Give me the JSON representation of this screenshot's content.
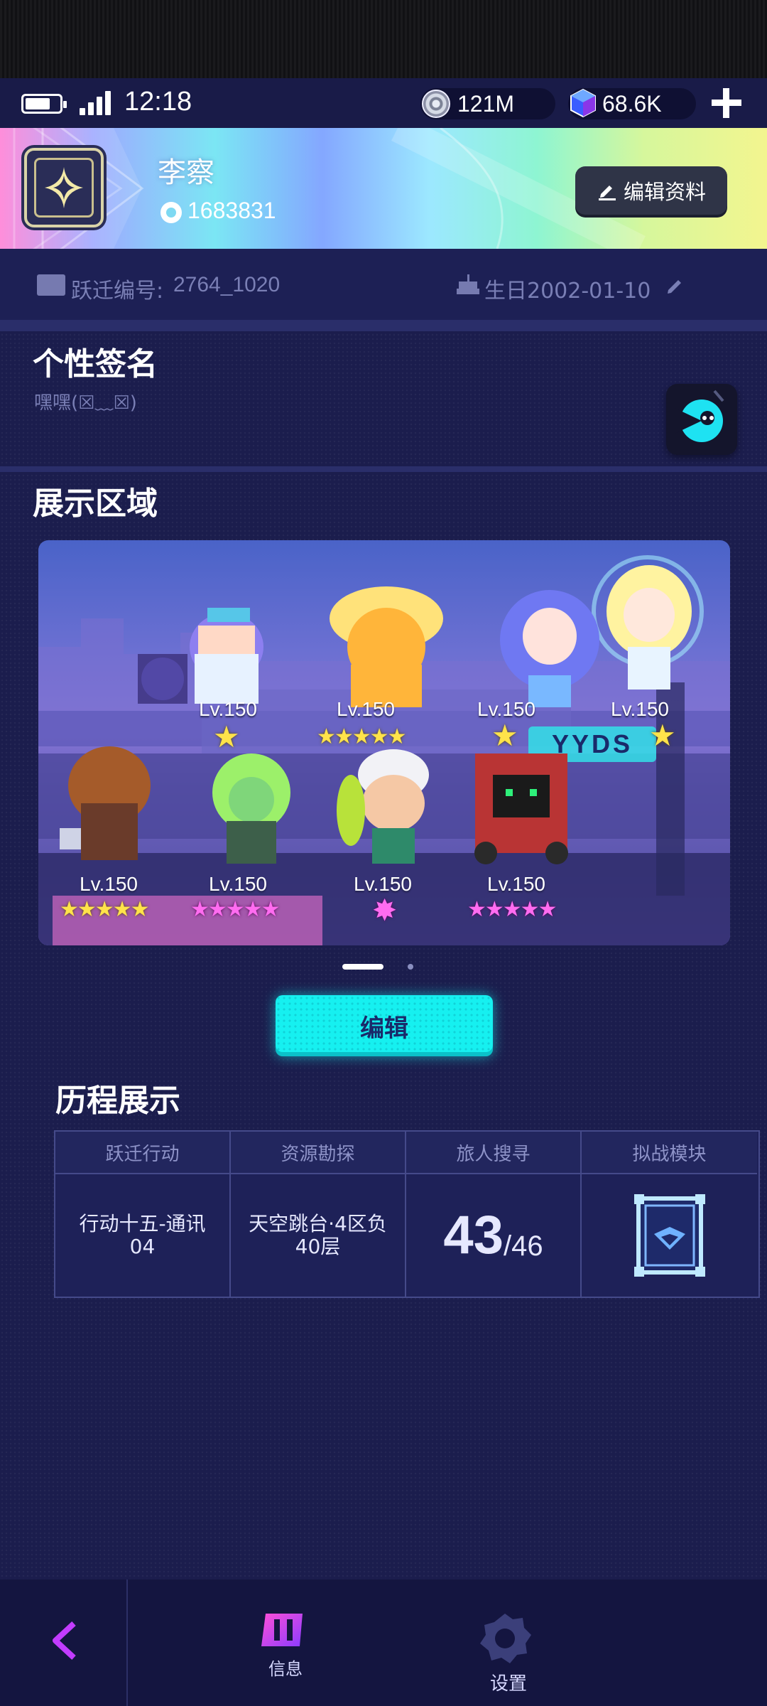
{
  "status_bar": {
    "time": "12:18",
    "coins": "121M",
    "gems": "68.6K",
    "icons": [
      "battery-icon",
      "signal-icon",
      "coin-icon",
      "gem-icon",
      "plus-icon"
    ]
  },
  "profile": {
    "name": "李察",
    "uid": "1683831",
    "edit_label": "编辑资料",
    "id_label": "跃迁编号:",
    "id_value": "2764_1020",
    "birthday": "生日2002-01-10"
  },
  "signature": {
    "title": "个性签名",
    "text": "嘿嘿(☒﹏☒)"
  },
  "showcase": {
    "title": "展示区域",
    "characters": [
      {
        "level": "Lv.150",
        "stars": "★",
        "star_color": "yellow"
      },
      {
        "level": "Lv.150",
        "stars": "★★★★★",
        "star_color": "yellow"
      },
      {
        "level": "Lv.150",
        "stars": "★",
        "star_color": "yellow"
      },
      {
        "level": "Lv.150",
        "stars": "★",
        "star_color": "yellow"
      },
      {
        "level": "Lv.150",
        "stars": "★★★★★",
        "star_color": "yellow"
      },
      {
        "level": "Lv.150",
        "stars": "★★★★★",
        "star_color": "pink"
      },
      {
        "level": "Lv.150",
        "stars": "✸",
        "star_color": "pink"
      },
      {
        "level": "Lv.150",
        "stars": "★★★★★",
        "star_color": "pink"
      }
    ],
    "sign_text": "YYDS",
    "page_count": 2,
    "active_page": 1,
    "edit_label": "编辑"
  },
  "history": {
    "title": "历程展示",
    "columns": [
      {
        "header": "跃迁行动",
        "value": "行动十五-通讯04"
      },
      {
        "header": "资源勘探",
        "value": "天空跳台·4区负40层"
      },
      {
        "header": "旅人搜寻",
        "value_big": "43",
        "value_small": "/46"
      },
      {
        "header": "拟战模块",
        "icon": "emblem-icon"
      }
    ]
  },
  "bottom_nav": {
    "back_icon": "back-arrow-icon",
    "items": [
      {
        "label": "信息",
        "icon": "info-icon",
        "active": true
      },
      {
        "label": "设置",
        "icon": "settings-icon",
        "active": false
      }
    ]
  },
  "colors": {
    "background": "#1b1d4d",
    "accent_cyan": "#16f0f0",
    "star_yellow": "#ffe34a",
    "star_pink": "#ff6cf0",
    "nav_active": "#c23cff"
  }
}
